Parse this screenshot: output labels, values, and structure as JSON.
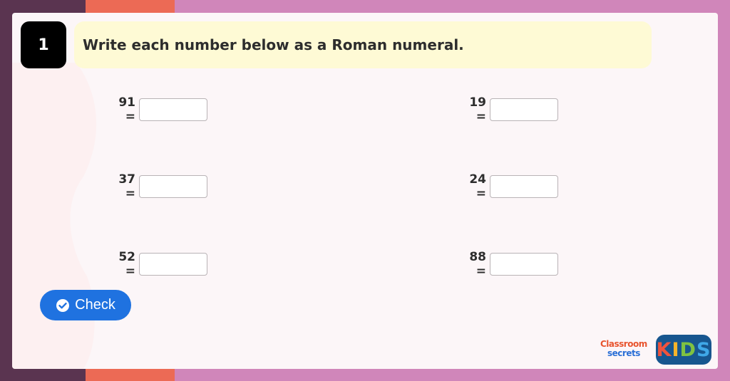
{
  "question": {
    "number": "1",
    "instruction": "Write each number below as a Roman numeral."
  },
  "equations": [
    {
      "label": "91 =",
      "value": ""
    },
    {
      "label": "19 =",
      "value": ""
    },
    {
      "label": "37 =",
      "value": ""
    },
    {
      "label": "24 =",
      "value": ""
    },
    {
      "label": "52 =",
      "value": ""
    },
    {
      "label": "88 =",
      "value": ""
    }
  ],
  "check_button": {
    "label": "Check"
  },
  "logos": {
    "classroom_secrets": {
      "line1": "Classroom",
      "line2": "secrets"
    },
    "kids": {
      "letters": [
        "K",
        "I",
        "D",
        "S"
      ],
      "colors": [
        "#f0533d",
        "#f5b42a",
        "#7fc241",
        "#3fa8e8"
      ]
    }
  },
  "colors": {
    "background_dark": "#5a3450",
    "background_orange": "#ec6a55",
    "background_pink": "#d086ba",
    "instruction_bg": "#fefad5",
    "button_blue": "#1f72e0"
  },
  "icons": {
    "check": "check-circle-icon"
  }
}
